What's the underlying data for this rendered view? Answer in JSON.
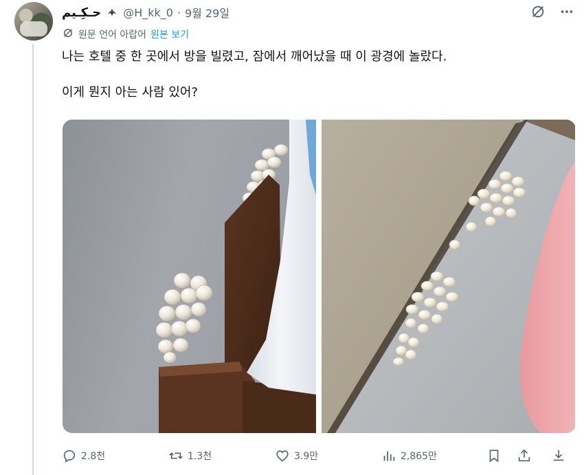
{
  "tweet": {
    "author": {
      "name": "حـكِـيم",
      "handle": "@H_kk_0",
      "flag_icon": "eagle-flag-icon"
    },
    "separator": "·",
    "date": "9월 29일",
    "translation": {
      "label": "원문 언어 아랍어",
      "show_original": "원본 보기"
    },
    "text_line1": "나는 호텔 중 한 곳에서 방을 빌렸고, 잠에서 깨어났을 때 이 광경에 놀랐다.",
    "text_line2": "이게 뭔지 아는 사람 있어?",
    "media": [
      {
        "description_icon": "photo-eggs-behind-bed"
      },
      {
        "description_icon": "photo-eggs-on-floor"
      }
    ],
    "stats": {
      "replies": "2.8천",
      "reposts": "1.3천",
      "likes": "3.9만",
      "views": "2,865만"
    }
  },
  "colors": {
    "text": "#0f1419",
    "secondary": "#536471",
    "accent": "#1d9bf0",
    "border": "#cfd9de"
  }
}
